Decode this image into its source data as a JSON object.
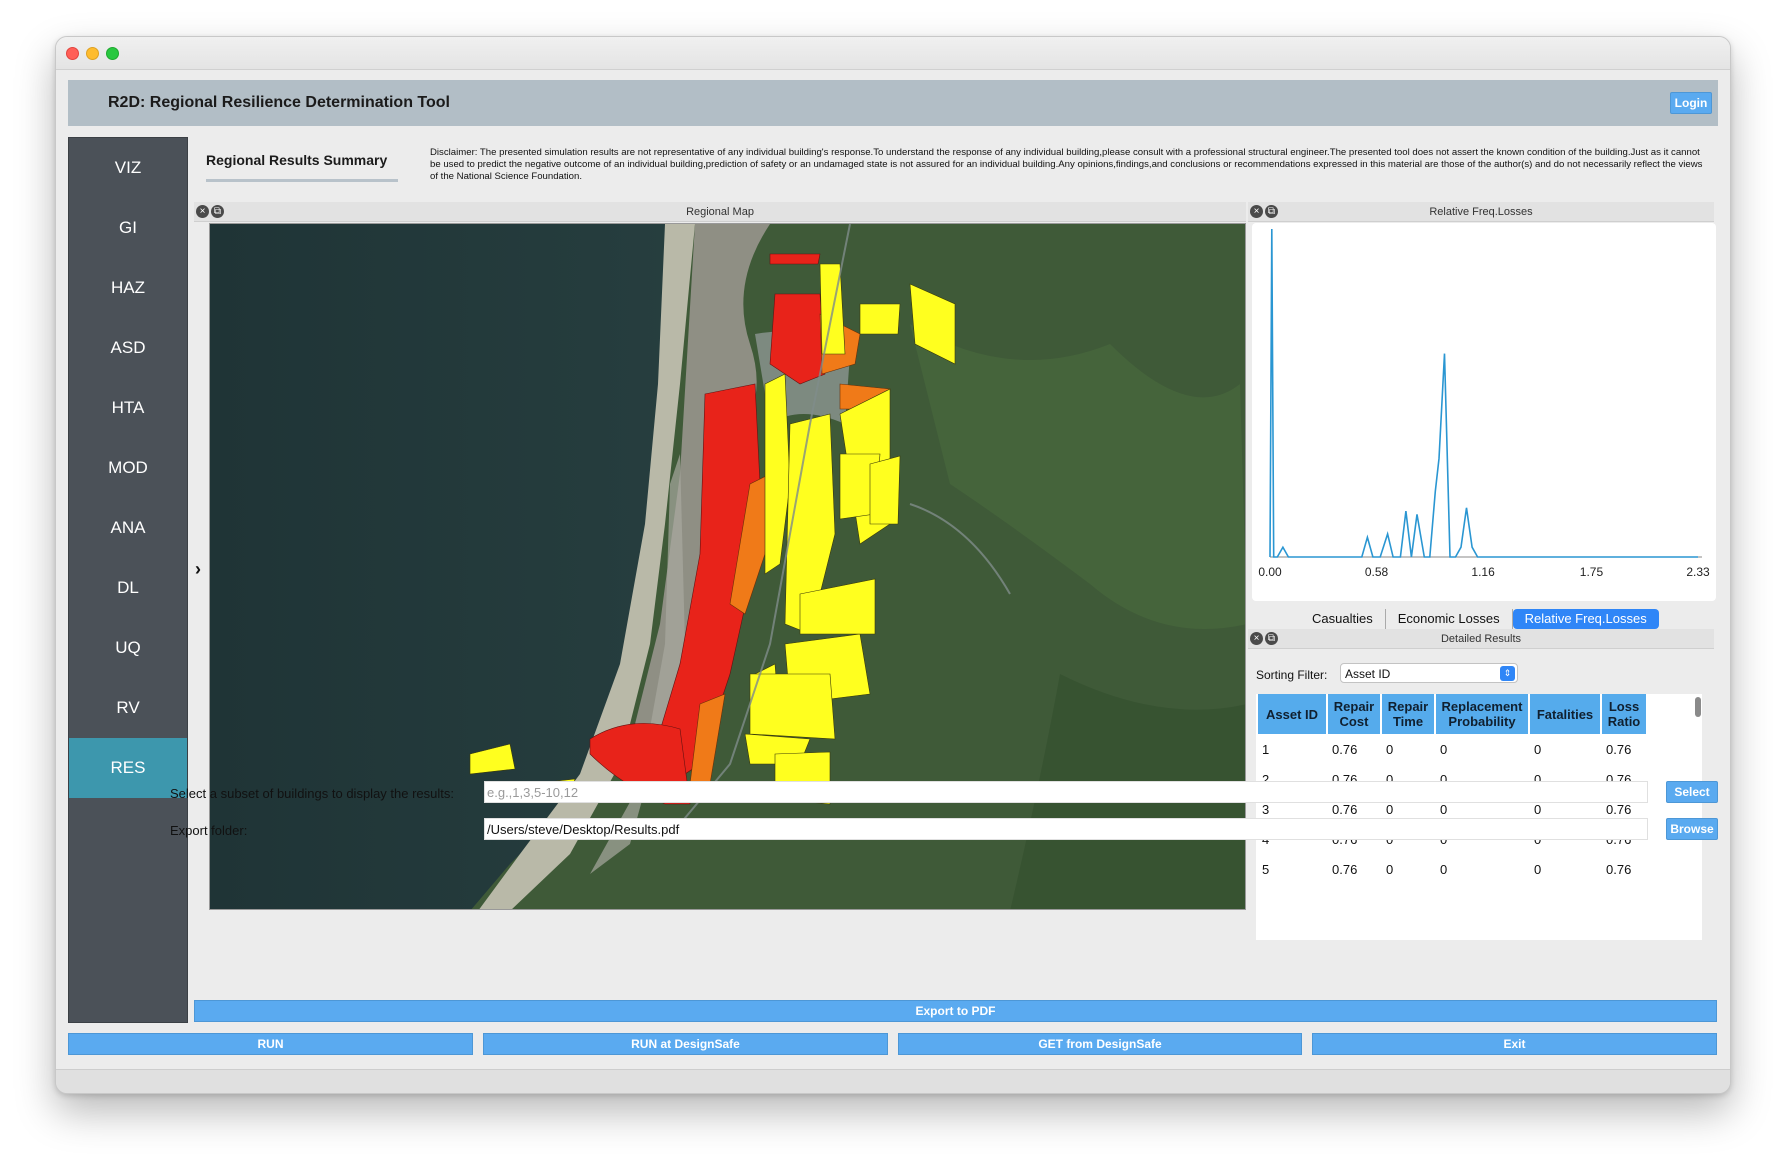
{
  "app": {
    "title": "R2D: Regional Resilience Determination Tool",
    "login_label": "Login"
  },
  "sidebar": {
    "items": [
      {
        "label": "VIZ"
      },
      {
        "label": "GI"
      },
      {
        "label": "HAZ"
      },
      {
        "label": "ASD"
      },
      {
        "label": "HTA"
      },
      {
        "label": "MOD"
      },
      {
        "label": "ANA"
      },
      {
        "label": "DL"
      },
      {
        "label": "UQ"
      },
      {
        "label": "RV"
      },
      {
        "label": "RES"
      }
    ],
    "active": "RES"
  },
  "summary": {
    "tab_label": "Regional Results Summary",
    "disclaimer": "Disclaimer: The presented simulation results are not representative of any individual building's response.To understand the response of any individual building,please consult with a professional structural engineer.The presented tool does not assert the known condition of the building.Just as it cannot be used to predict the negative outcome of an individual building,prediction of safety or an undamaged state is not assured for an individual building.Any opinions,findings,and conclusions or recommendations expressed in this material are those of the author(s) and do not necessarily reflect the views of the National Science Foundation."
  },
  "map": {
    "title": "Regional Map",
    "expand_glyph": "›"
  },
  "chart": {
    "panel_title": "Relative Freq.Losses",
    "tabs": [
      "Casualties",
      "Economic Losses",
      "Relative Freq.Losses"
    ],
    "active_tab": "Relative Freq.Losses"
  },
  "chart_data": {
    "type": "line",
    "x_ticks": [
      "0.00",
      "0.58",
      "1.16",
      "1.75",
      "2.33"
    ],
    "xlim": [
      0,
      2.33
    ],
    "ylim": [
      0,
      1
    ],
    "color": "#2a96d2",
    "x": [
      0.0,
      0.01,
      0.02,
      0.04,
      0.07,
      0.1,
      0.13,
      0.16,
      0.2,
      0.26,
      0.34,
      0.4,
      0.46,
      0.5,
      0.53,
      0.56,
      0.6,
      0.64,
      0.67,
      0.71,
      0.74,
      0.77,
      0.8,
      0.84,
      0.87,
      0.9,
      0.92,
      0.95,
      0.98,
      1.01,
      1.04,
      1.07,
      1.1,
      1.13,
      1.16,
      1.19,
      1.22,
      1.25,
      1.3,
      1.5,
      2.0,
      2.33
    ],
    "y": [
      0.0,
      1.0,
      0.0,
      0.0,
      0.03,
      0.0,
      0.0,
      0.0,
      0.0,
      0.0,
      0.0,
      0.0,
      0.0,
      0.0,
      0.06,
      0.0,
      0.0,
      0.07,
      0.0,
      0.0,
      0.14,
      0.0,
      0.13,
      0.0,
      0.0,
      0.2,
      0.3,
      0.62,
      0.0,
      0.0,
      0.03,
      0.15,
      0.03,
      0.0,
      0.0,
      0.0,
      0.0,
      0.0,
      0.0,
      0.0,
      0.0,
      0.0
    ]
  },
  "results": {
    "panel_title": "Detailed Results",
    "sort_label": "Sorting Filter:",
    "sort_value": "Asset ID",
    "columns": [
      [
        "Asset ID"
      ],
      [
        "Repair",
        "Cost"
      ],
      [
        "Repair",
        "Time"
      ],
      [
        "Replacement",
        "Probability"
      ],
      [
        "Fatalities"
      ],
      [
        "Loss",
        "Ratio"
      ]
    ],
    "rows": [
      [
        "1",
        "0.76",
        "0",
        "0",
        "0",
        "0.76"
      ],
      [
        "2",
        "0.76",
        "0",
        "0",
        "0",
        "0.76"
      ],
      [
        "3",
        "0.76",
        "0",
        "0",
        "0",
        "0.76"
      ],
      [
        "4",
        "0.76",
        "0",
        "0",
        "0",
        "0.76"
      ],
      [
        "5",
        "0.76",
        "0",
        "0",
        "0",
        "0.76"
      ]
    ]
  },
  "form": {
    "subset_label": "Select a subset of buildings to display the results:",
    "subset_placeholder": "e.g.,1,3,5-10,12",
    "subset_button": "Select",
    "export_label": "Export folder:",
    "export_value": "/Users/steve/Desktop/Results.pdf",
    "browse_button": "Browse",
    "export_pdf_button": "Export to PDF"
  },
  "actions": {
    "run": "RUN",
    "run_designsafe": "RUN at DesignSafe",
    "get_designsafe": "GET from DesignSafe",
    "exit": "Exit"
  },
  "colors": {
    "header": "#b2bec6",
    "sidebar": "#4b5158",
    "sidebar_active": "#3d97ad",
    "button": "#5aaaf0",
    "table_header": "#55abec",
    "high_loss": "#e8231a",
    "mid_loss": "#f07a18",
    "low_loss": "#ffff1f"
  }
}
